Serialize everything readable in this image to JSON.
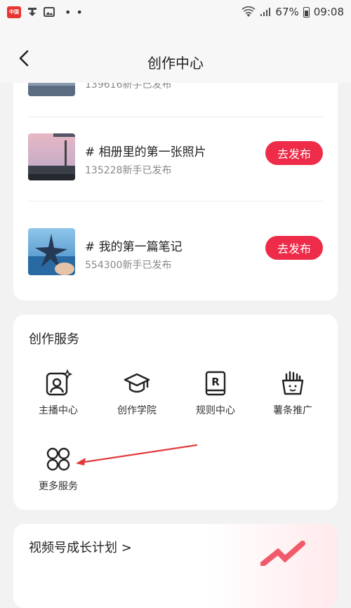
{
  "status_bar": {
    "app_badge": "中国",
    "battery_percent": "67%",
    "time": "09:08"
  },
  "nav": {
    "title": "创作中心"
  },
  "tasks": [
    {
      "title": "",
      "subtitle": "139616新手已发布"
    },
    {
      "title": "# 相册里的第一张照片",
      "subtitle": "135228新手已发布",
      "button": "去发布"
    },
    {
      "title": "# 我的第一篇笔记",
      "subtitle": "554300新手已发布",
      "button": "去发布"
    }
  ],
  "services": {
    "title": "创作服务",
    "items": [
      {
        "label": "主播中心",
        "icon": "anchor-icon"
      },
      {
        "label": "创作学院",
        "icon": "graduation-cap-icon"
      },
      {
        "label": "规则中心",
        "icon": "rules-book-icon"
      },
      {
        "label": "薯条推广",
        "icon": "fries-icon"
      },
      {
        "label": "更多服务",
        "icon": "grid-circles-icon"
      }
    ]
  },
  "growth": {
    "title": "视频号成长计划 >"
  },
  "colors": {
    "accent": "#ee2b48",
    "card_bg": "#ffffff",
    "page_bg": "#f2f2f2",
    "annotation_arrow": "#e23a3a"
  }
}
